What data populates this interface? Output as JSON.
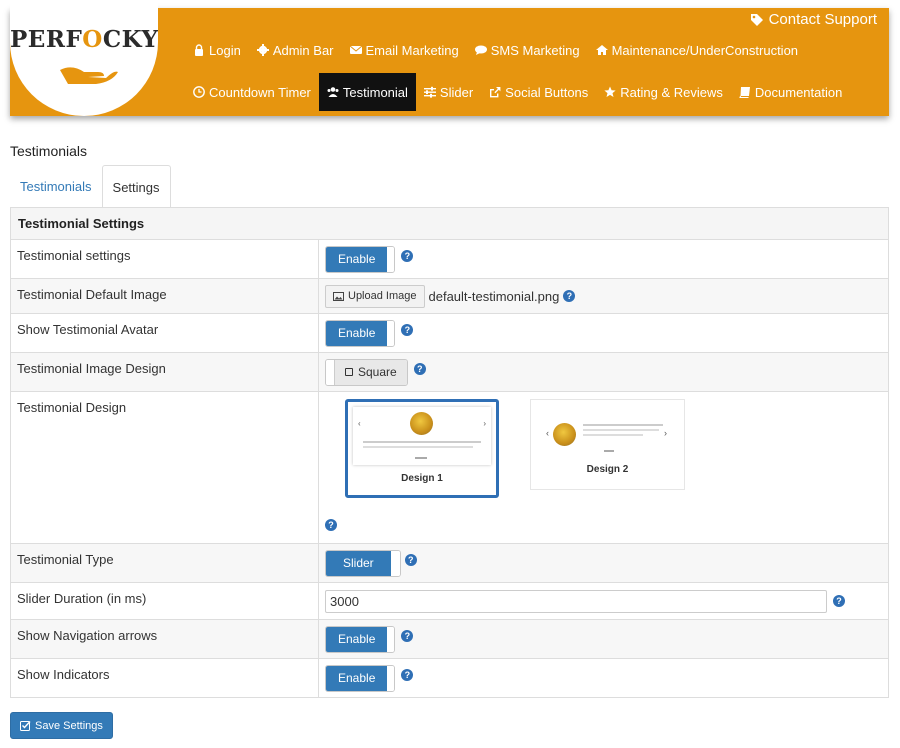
{
  "brand": {
    "logo_prefix": "PERF",
    "logo_o": "O",
    "logo_suffix": "CKY"
  },
  "header": {
    "contact_support": "Contact Support",
    "nav_row1": [
      {
        "label": "Login",
        "icon": "lock-icon"
      },
      {
        "label": "Admin Bar",
        "icon": "gear-icon"
      },
      {
        "label": "Email Marketing",
        "icon": "envelope-icon"
      },
      {
        "label": "SMS Marketing",
        "icon": "chat-icon"
      },
      {
        "label": "Maintenance/UnderConstruction",
        "icon": "home-icon"
      }
    ],
    "nav_row2": [
      {
        "label": "Countdown Timer",
        "icon": "clock-icon"
      },
      {
        "label": "Testimonial",
        "icon": "users-icon",
        "active": true
      },
      {
        "label": "Slider",
        "icon": "sliders-icon"
      },
      {
        "label": "Social Buttons",
        "icon": "share-icon"
      },
      {
        "label": "Rating & Reviews",
        "icon": "star-icon"
      },
      {
        "label": "Documentation",
        "icon": "book-icon"
      }
    ]
  },
  "page": {
    "title": "Testimonials",
    "tabs": [
      "Testimonials",
      "Settings"
    ],
    "active_tab": "Settings"
  },
  "settings": {
    "section_title": "Testimonial Settings",
    "rows": {
      "testimonial_settings": {
        "label": "Testimonial settings",
        "value": "Enable"
      },
      "default_image": {
        "label": "Testimonial Default Image",
        "button": "Upload Image",
        "filename": "default-testimonial.png"
      },
      "show_avatar": {
        "label": "Show Testimonial Avatar",
        "value": "Enable"
      },
      "image_design": {
        "label": "Testimonial Image Design",
        "value": "Square"
      },
      "design": {
        "label": "Testimonial Design",
        "options": [
          "Design 1",
          "Design 2"
        ],
        "selected": "Design 1"
      },
      "type": {
        "label": "Testimonial Type",
        "value": "Slider"
      },
      "slider_duration": {
        "label": "Slider Duration (in ms)",
        "value": "3000"
      },
      "nav_arrows": {
        "label": "Show Navigation arrows",
        "value": "Enable"
      },
      "indicators": {
        "label": "Show Indicators",
        "value": "Enable"
      }
    },
    "help_glyph": "?"
  },
  "footer": {
    "save_label": "Save Settings"
  },
  "colors": {
    "header_bg": "#e6950f",
    "primary": "#337ab7",
    "active_nav": "#111111"
  }
}
